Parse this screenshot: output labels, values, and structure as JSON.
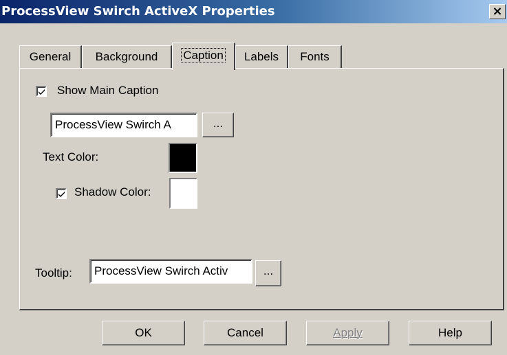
{
  "window": {
    "title": "ProcessView Swirch ActiveX Properties",
    "close_label": "×"
  },
  "tabs": [
    {
      "label": "General"
    },
    {
      "label": "Background"
    },
    {
      "label": "Caption",
      "active": true
    },
    {
      "label": "Labels"
    },
    {
      "label": "Fonts"
    }
  ],
  "caption_tab": {
    "show_main_caption": {
      "label": "Show Main Caption",
      "checked": true
    },
    "caption_value": "ProcessView Swirch A",
    "browse_label": "...",
    "text_color": {
      "label": "Text Color:",
      "color": "#000000"
    },
    "shadow_color": {
      "label": "Shadow Color:",
      "checked": true,
      "color": "#ffffff"
    },
    "tooltip": {
      "label": "Tooltip:",
      "value": "ProcessView Swirch Activ",
      "browse_label": "..."
    }
  },
  "buttons": {
    "ok": "OK",
    "cancel": "Cancel",
    "apply": "Apply",
    "help": "Help"
  }
}
